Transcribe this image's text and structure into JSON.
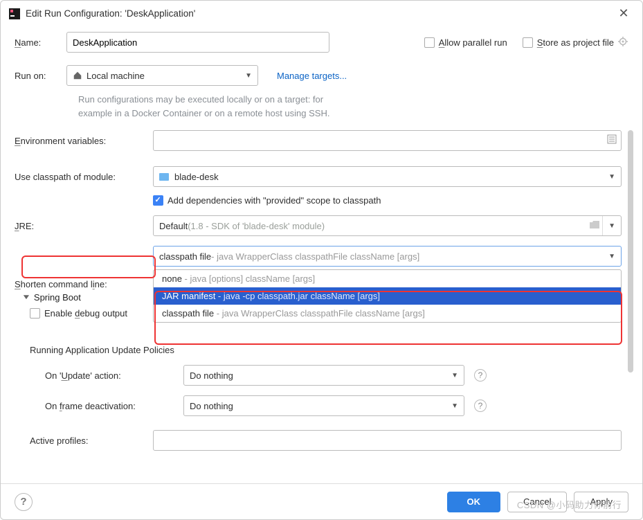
{
  "window": {
    "title": "Edit Run Configuration: 'DeskApplication'"
  },
  "top": {
    "name_label": "Name:",
    "name_value": "DeskApplication",
    "allow_parallel_label": "Allow parallel run",
    "store_project_label": "Store as project file"
  },
  "runon": {
    "label": "Run on:",
    "value": "Local machine",
    "manage_link": "Manage targets...",
    "help_line1": "Run configurations may be executed locally or on a target: for",
    "help_line2": "example in a Docker Container or on a remote host using SSH."
  },
  "form": {
    "env_label": "Environment variables:",
    "env_value": "",
    "classpath_label": "Use classpath of module:",
    "classpath_value": "blade-desk",
    "deps_label": "Add dependencies with \"provided\" scope to classpath",
    "jre_label": "JRE:",
    "jre_value": "Default",
    "jre_hint": " (1.8 - SDK of 'blade-desk' module)",
    "shorten_label": "Shorten command line:",
    "shorten_value": "classpath file",
    "shorten_hint": " - java WrapperClass classpathFile className [args]",
    "options": {
      "none_main": "none",
      "none_hint": " - java [options] className [args]",
      "jar_main": "JAR manifest",
      "jar_hint": " - java -cp classpath.jar className [args]",
      "cpf_main": "classpath file",
      "cpf_hint": " - java WrapperClass classpathFile className [args]"
    }
  },
  "spring": {
    "header": "Spring Boot",
    "debug_label": "Enable debug output",
    "policies_header": "Running Application Update Policies",
    "update_label": "On 'Update' action:",
    "update_value": "Do nothing",
    "frame_label": "On frame deactivation:",
    "frame_value": "Do nothing",
    "profiles_label": "Active profiles:",
    "profiles_value": ""
  },
  "footer": {
    "ok": "OK",
    "cancel": "Cancel",
    "apply": "Apply"
  },
  "watermark": "CSDN @小码助力你前行"
}
